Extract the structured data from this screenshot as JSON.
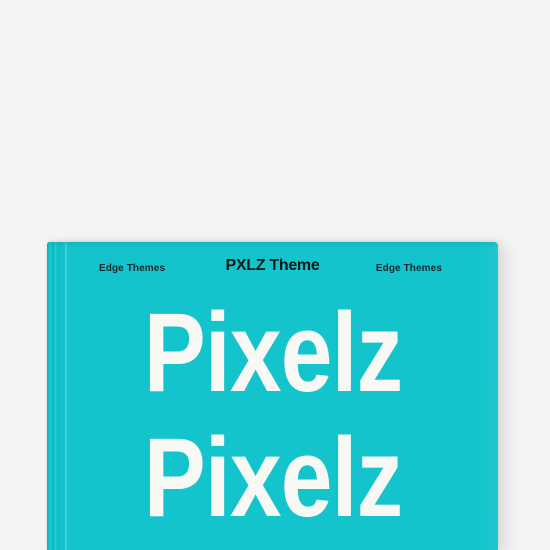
{
  "book": {
    "header": {
      "left_label": "Edge Themes",
      "center_label": "PXLZ Theme",
      "right_label": "Edge Themes"
    },
    "title_lines": [
      "Pixelz",
      "Pixelz"
    ]
  },
  "colors": {
    "background": "#f4f4f4",
    "cover": "#14c4cc",
    "title_text": "#f8f8f4",
    "header_text": "#091818"
  }
}
